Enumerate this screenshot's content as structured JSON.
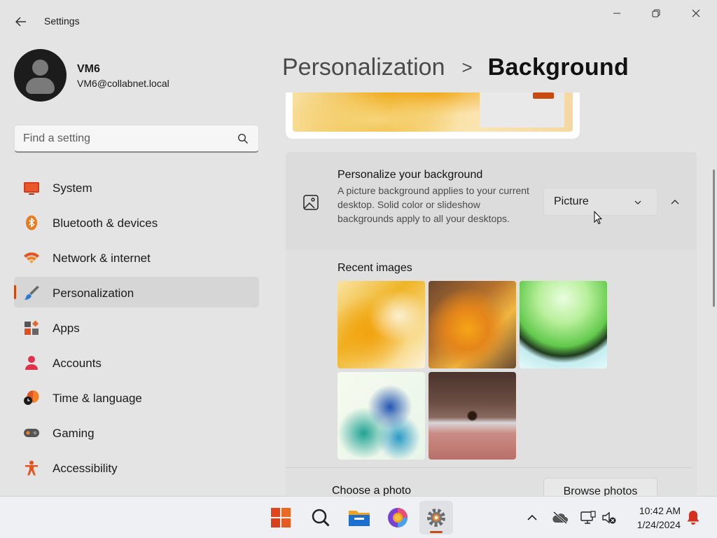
{
  "window": {
    "app_title": "Settings",
    "controls": [
      "minimize",
      "maximize",
      "close"
    ]
  },
  "profile": {
    "name": "VM6",
    "email": "VM6@collabnet.local"
  },
  "search": {
    "placeholder": "Find a setting"
  },
  "nav": {
    "items": [
      {
        "label": "System",
        "icon": "monitor-icon"
      },
      {
        "label": "Bluetooth & devices",
        "icon": "bluetooth-icon"
      },
      {
        "label": "Network & internet",
        "icon": "wifi-icon"
      },
      {
        "label": "Personalization",
        "icon": "brush-icon",
        "active": true
      },
      {
        "label": "Apps",
        "icon": "apps-icon"
      },
      {
        "label": "Accounts",
        "icon": "person-icon"
      },
      {
        "label": "Time & language",
        "icon": "globe-clock-icon"
      },
      {
        "label": "Gaming",
        "icon": "gamepad-icon"
      },
      {
        "label": "Accessibility",
        "icon": "accessibility-icon"
      }
    ]
  },
  "header": {
    "parent": "Personalization",
    "separator": ">",
    "current": "Background"
  },
  "background_card": {
    "title": "Personalize your background",
    "description": "A picture background applies to your current desktop. Solid color or slideshow backgrounds apply to all your desktops.",
    "dropdown_value": "Picture",
    "expanded": true
  },
  "recent_images": {
    "label": "Recent images",
    "images": [
      "bloom-light-yellow",
      "bloom-dark-orange",
      "green-glow",
      "blue-teal-ribbon",
      "sunset-horizon"
    ]
  },
  "choose_photo": {
    "label": "Choose a photo",
    "button": "Browse photos"
  },
  "taskbar": {
    "apps": [
      "start-icon",
      "search-icon",
      "file-explorer-icon",
      "browser-icon",
      "settings-icon"
    ],
    "active_app": "settings-icon",
    "tray": [
      "chevron-up-icon",
      "cloud-off-icon",
      "network-monitor-icon",
      "volume-muted-icon"
    ],
    "time": "10:42 AM",
    "date": "1/24/2024",
    "notification_icon": "bell-icon"
  },
  "colors": {
    "accent": "#c74a10",
    "background": "#e4e4e4",
    "card": "#dcdcdc",
    "taskbar": "#eef0f3"
  }
}
